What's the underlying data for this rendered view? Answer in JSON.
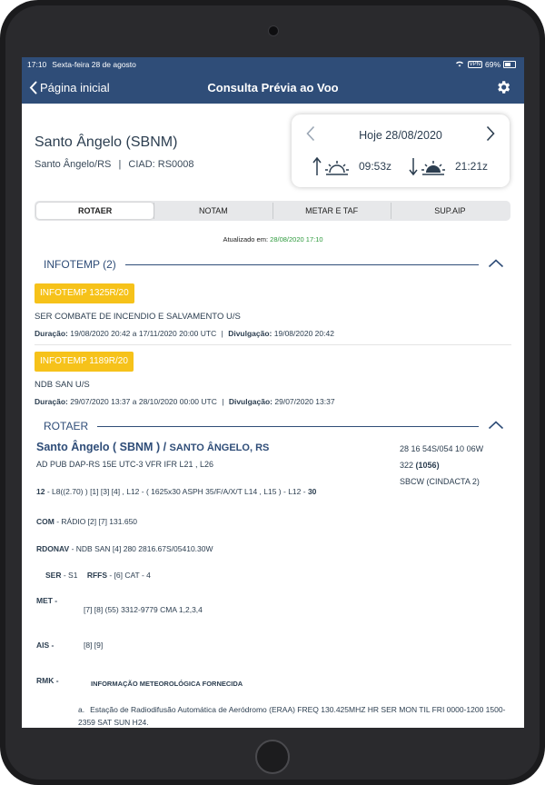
{
  "status_bar": {
    "time": "17:10",
    "date": "Sexta-feira 28 de agosto",
    "vpn": "VPN",
    "battery": "69%"
  },
  "nav": {
    "back_label": "Página inicial",
    "title": "Consulta Prévia ao Voo"
  },
  "airport": {
    "name": "Santo Ângelo (SBNM)",
    "city": "Santo Ângelo/RS",
    "ciad_label": "CIAD: RS0008"
  },
  "date_card": {
    "date": "Hoje 28/08/2020",
    "sunrise": "09:53z",
    "sunset": "21:21z"
  },
  "tabs": [
    {
      "label": "ROTAER",
      "active": true
    },
    {
      "label": "NOTAM",
      "active": false
    },
    {
      "label": "METAR E TAF",
      "active": false
    },
    {
      "label": "SUP.AIP",
      "active": false
    }
  ],
  "updated": {
    "label": "Atualizado em:",
    "value": "28/08/2020 17:10"
  },
  "infotemp": {
    "header": "INFOTEMP (2)",
    "items": [
      {
        "badge": "INFOTEMP  1325R/20",
        "text": "SER COMBATE DE INCENDIO E SALVAMENTO U/S",
        "duration_label": "Duração:",
        "duration": "19/08/2020 20:42 a 17/11/2020 20:00 UTC",
        "sep": "|",
        "disclosure_label": "Divulgação:",
        "disclosure": "19/08/2020 20:42"
      },
      {
        "badge": "INFOTEMP  1189R/20",
        "text": "NDB SAN U/S",
        "duration_label": "Duração:",
        "duration": "29/07/2020 13:37 a 28/10/2020 00:00 UTC",
        "sep": "|",
        "disclosure_label": "Divulgação:",
        "disclosure": "29/07/2020 13:37"
      }
    ]
  },
  "rotaer": {
    "header": "ROTAER",
    "title": "Santo Ângelo ( SBNM ) /",
    "title_city": "SANTO ÂNGELO, RS",
    "subtitle": "AD PUB DAP-RS 15E UTC-3 VFR IFR L21 , L26",
    "coords": "28 16 54S/054 10 06W",
    "elevation": "322",
    "elevation_ft": "(1056)",
    "fir": "SBCW (CINDACTA 2)",
    "rwy_start": "12",
    "rwy_text": " - L8((2.70) ) [1] [3] [4] , L12 - ( 1625x30 ASPH 35/F/A/X/T L14 , L15 ) - L12 - ",
    "rwy_end": "30",
    "com_label": "COM",
    "com_text": " - RÁDIO [2] [7] 131.650",
    "rdonav_label": "RDONAV",
    "rdonav_text": " - NDB SAN [4] 280 2816.67S/05410.30W",
    "ser_label": "SER",
    "ser_text": " - S1",
    "rffs_label": "RFFS",
    "rffs_text": " - [6] CAT - 4",
    "met_label": "MET -",
    "met_text": "[7] [8] (55) 3312-9779 CMA 1,2,3,4",
    "ais_label": "AIS -",
    "ais_text": "[8] [9]",
    "rmk_label": "RMK -",
    "rmk_head": "INFORMAÇÃO METEOROLÓGICA FORNECIDA",
    "rmk_item_marker": "a.",
    "rmk_item": "Estação de Radiodifusão Automática de Aeródromo (ERAA) FREQ 130.425MHZ HR SER MON TIL FRI 0000-1200 1500-2359 SAT SUN H24."
  },
  "colors": {
    "nav_bg": "#2f4d78",
    "badge": "#f6c21a",
    "updated_value": "#2e9a3d",
    "text": "#2c3e50"
  }
}
